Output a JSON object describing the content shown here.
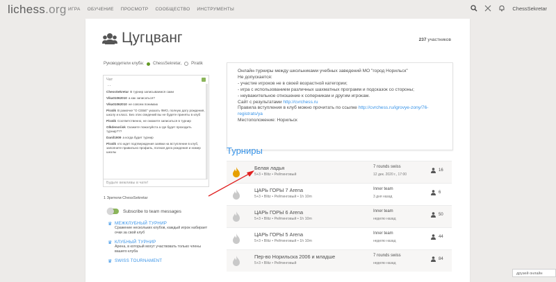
{
  "nav": {
    "logo_main": "lichess",
    "logo_tld": ".org",
    "menu": [
      "ИГРА",
      "ОБУЧЕНИЕ",
      "ПРОСМОТР",
      "СООБЩЕСТВО",
      "ИНСТРУМЕНТЫ"
    ],
    "username": "ChessSekretar"
  },
  "team": {
    "title": "Цугцванг",
    "members_count": "237",
    "members_label": "участников",
    "leaders_label": "Руководители клуба:",
    "leader1": "ChessSekretar,",
    "leader2": "Piratik"
  },
  "chat": {
    "header": "Чат",
    "messages": [
      {
        "user": "",
        "text": "-   -"
      },
      {
        "user": "ChessSekretar",
        "text": "В турнир записываемся сами"
      },
      {
        "user": "Vika01062010",
        "text": "а как записаться?"
      },
      {
        "user": "Vika01062010",
        "text": "не совсем понимаю"
      },
      {
        "user": "Piratik",
        "text": "В рамочке \"О СЕБЕ\" указать ФИО, полную дату рождения, школу и класс. Без этих сведений вы не будете приняты в клуб"
      },
      {
        "user": "Piratik",
        "text": "Соответственно, не сможете записаться в турнир"
      },
      {
        "user": "Olkdenoriisk",
        "text": "Скажите пожалуйста а где будет проходить турнир???"
      },
      {
        "user": "Danil1909",
        "text": "а когда будет турнир"
      },
      {
        "user": "Piratik",
        "text": "кто ждет подтверждения заявки на вступление в клуб, заполните правильно профиль, полная дата рождения и номер школы"
      }
    ],
    "input_placeholder": "Будьте вежливы в чате!"
  },
  "sidebar": {
    "viewers": "1 Зрители ChessSekretar",
    "subscribe": "Subscribe to team messages",
    "tournaments": [
      {
        "name": "МЕЖКЛУБНЫЙ ТУРНИР",
        "desc": "Сражение нескольких клубов, каждый игрок набирает очки за свой клуб"
      },
      {
        "name": "КЛУБНЫЙ ТУРНИР",
        "desc": "Арена, в который могут участвовать только члены вашего клуба"
      },
      {
        "name": "SWISS TOURNAMENT",
        "desc": ""
      }
    ]
  },
  "description": {
    "lines": [
      "Онлайн-турниры между школьниками учебных заведений МО \"город Норильск\"",
      "Не допускается:",
      "- участие игроков не в своей возрастной категории;",
      "- игра с использованием различных шахматных программ и подсказок со стороны;",
      "- неуважительное отношение к соперникам и другим игрокам.",
      "Сайт с результатами",
      "Правила вступления в клуб можно прочитать по ссылке",
      "registrats/ya",
      "Местоположение: Норильск"
    ],
    "results_link": "http://cvrchess.ru",
    "rules_link": "http://cvrchess.ru/igrovye-zony/76-"
  },
  "tournaments_section": {
    "title": "Турниры",
    "rows": [
      {
        "name": "Белая ладья",
        "sub": "5+3 • Blitz • Рейтинговый",
        "type": "7 rounds swiss",
        "date": "12 дек. 2020 г., 17:00",
        "players": "16",
        "hot": true
      },
      {
        "name": "ЦАРЬ ГОРЫ 7 Arena",
        "sub": "5+3 • Blitz • Рейтинговый • 1h 10m",
        "type": "Inner team",
        "date": "3 дня назад",
        "players": "6",
        "hot": false
      },
      {
        "name": "ЦАРЬ ГОРЫ 6 Arena",
        "sub": "5+3 • Blitz • Рейтинговый • 1h 10m",
        "type": "Inner team",
        "date": "неделю назад",
        "players": "50",
        "hot": false
      },
      {
        "name": "ЦАРЬ ГОРЫ 5 Arena",
        "sub": "5+3 • Blitz • Рейтинговый • 1h 10m",
        "type": "Inner team",
        "date": "неделю назад",
        "players": "44",
        "hot": false
      },
      {
        "name": "Пер-во Норильска 2006 и младше",
        "sub": "5+3 • Blitz • Рейтинговый",
        "type": "7 rounds swiss",
        "date": "неделю назад",
        "players": "84",
        "hot": false
      }
    ]
  },
  "friends": "друзей онлайн",
  "colors": {
    "accent": "#3692e7",
    "flame_active": "#e69f00",
    "flame_inactive": "#c9c9c9",
    "green": "#629924"
  }
}
